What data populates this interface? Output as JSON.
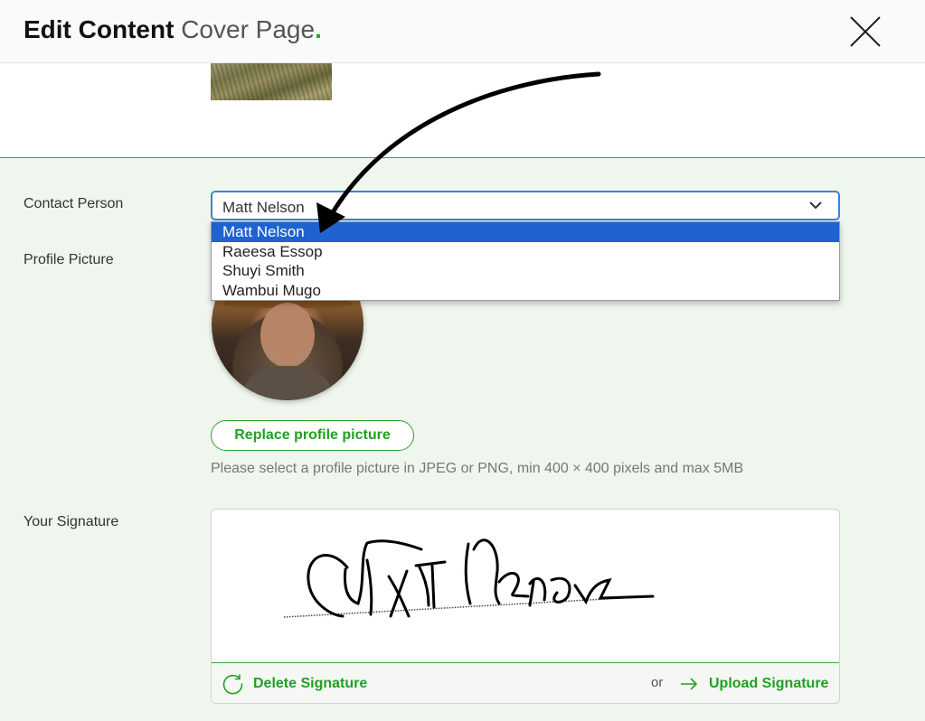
{
  "header": {
    "title_strong": "Edit Content",
    "title_sub": "Cover Page",
    "title_dot": ".",
    "close_icon": "close-x-icon"
  },
  "form": {
    "contact_label": "Contact Person",
    "contact_selected": "Matt Nelson",
    "contact_options": [
      "Matt Nelson",
      "Raeesa Essop",
      "Shuyi Smith",
      "Wambui Mugo"
    ],
    "profile_label": "Profile Picture",
    "replace_button": "Replace profile picture",
    "profile_hint": "Please select a profile picture in JPEG or PNG, min 400 × 400 pixels and max 5MB",
    "signature_label": "Your Signature",
    "delete_signature": "Delete Signature",
    "or_text": "or",
    "upload_signature": "Upload Signature"
  },
  "colors": {
    "accent_green": "#22a022",
    "select_highlight": "#1e63d0",
    "form_background": "#eff6ee",
    "focus_border": "#3b82d6"
  },
  "icons": [
    "close-x-icon",
    "chevron-down-icon",
    "refresh-icon",
    "arrow-right-icon",
    "annotation-arrow"
  ]
}
